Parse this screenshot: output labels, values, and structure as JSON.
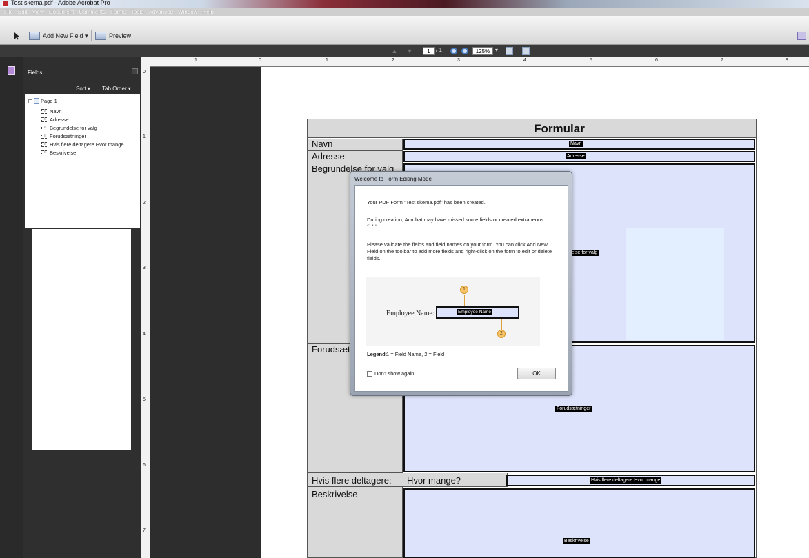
{
  "window": {
    "title": "Test skema.pdf - Adobe Acrobat Pro"
  },
  "menu": [
    "File",
    "Edit",
    "View",
    "Document",
    "Comments",
    "Forms",
    "Tools",
    "Advanced",
    "Window",
    "Help"
  ],
  "toolbar": {
    "add_new_field": "Add New Field ▾",
    "preview": "Preview"
  },
  "navigation": {
    "current_page": "1",
    "total_pages": "/ 1",
    "zoom": "125%",
    "zoom_dropdown": "▾"
  },
  "fields_panel": {
    "title": "Fields",
    "sort": "Sort ▾",
    "tab_order": "Tab Order ▾",
    "page": "Page 1",
    "items": [
      "Navn",
      "Adresse",
      "Begrundelse for valg",
      "Forudsætninger",
      "Hvis flere deltagere Hvor mange",
      "Beskrivelse"
    ]
  },
  "rulers": {
    "h": [
      "1",
      "0",
      "1",
      "2",
      "3",
      "4",
      "5",
      "6",
      "7",
      "8"
    ],
    "v": [
      "0",
      "1",
      "2",
      "3",
      "4",
      "5",
      "6",
      "7"
    ]
  },
  "form": {
    "title": "Formular",
    "labels": {
      "navn": "Navn",
      "adresse": "Adresse",
      "begrundelse": "Begrundelse for valg",
      "forudsaetninger": "Forudsæt",
      "hvis": "Hvis flere deltagere:",
      "hvor": "Hvor mange?",
      "beskrivelse": "Beskrivelse"
    },
    "field_names": {
      "navn": "Navn",
      "adresse": "Adresse",
      "begrundelse": "lelse for valg",
      "forudsaetninger": "Forudsætninger",
      "hvis": "Hvis flere deltagere Hvor mange",
      "beskrivelse": "Beskrivelse"
    }
  },
  "dialog": {
    "title": "Welcome to Form Editing Mode",
    "p1": "Your PDF Form \"Test skema.pdf\" has been created.",
    "p2": "During creation, Acrobat may have missed some fields or created extraneous fields.",
    "p3": "Please validate the fields and field names on your form. You can click Add New Field on the toolbar to add more fields and right-click on the form to edit or delete fields.",
    "illustration_label": "Employee Name:",
    "illustration_field": "Employee Name",
    "callout1": "1",
    "callout2": "2",
    "legend_label": "Legend:",
    "legend_text": "1 = Field Name, 2 = Field",
    "dont_show": "Don't show again",
    "ok": "OK"
  },
  "colors": {
    "field_fill": "#dde3fb",
    "label_fill": "#d9d9d9",
    "callout": "#f7c56b"
  }
}
